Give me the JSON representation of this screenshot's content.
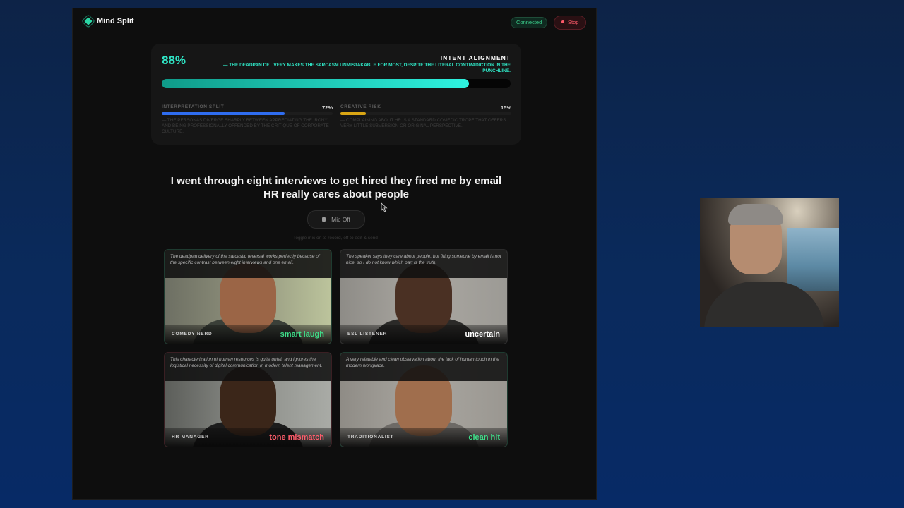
{
  "app": {
    "title": "Mind Split",
    "status": "Connected",
    "stop_label": "Stop"
  },
  "intent": {
    "percent_label": "88%",
    "value": 0.88,
    "title": "INTENT ALIGNMENT",
    "description": "— THE DEADPAN DELIVERY MAKES THE SARCASM UNMISTAKABLE FOR MOST, DESPITE THE LITERAL CONTRADICTION IN THE PUNCHLINE."
  },
  "metrics": [
    {
      "label": "INTERPRETATION SPLIT",
      "value_label": "72%",
      "value": 0.72,
      "color": "#2f6df0",
      "description": "— THE PERSONAS DIVERGE SHARPLY BETWEEN APPRECIATING THE IRONY AND BEING PROFESSIONALLY OFFENDED BY THE CRITIQUE OF CORPORATE CULTURE."
    },
    {
      "label": "CREATIVE RISK",
      "value_label": "15%",
      "value": 0.15,
      "color": "#d9a514",
      "description": "— COMPLAINING ABOUT HR IS A STANDARD COMEDIC TROPE THAT OFFERS VERY LITTLE SUBVERSION OR ORIGINAL PERSPECTIVE."
    }
  ],
  "utterance": "I went through eight interviews to get hired they fired me by email HR really cares about people",
  "mic": {
    "label": "Mic Off",
    "icon": "microphone-icon",
    "hint": "Toggle mic on to record, off to edit & send"
  },
  "personas": [
    {
      "role": "COMEDY NERD",
      "verdict": "smart laugh",
      "verdict_color": "#3ee08a",
      "quote": "The deadpan delivery of the sarcastic reversal works perfectly because of the specific contrast between eight interviews and one email."
    },
    {
      "role": "ESL LISTENER",
      "verdict": "uncertain",
      "verdict_color": "#ffffff",
      "quote": "The speaker says they care about people, but firing someone by email is not nice, so I do not know which part is the truth."
    },
    {
      "role": "HR MANAGER",
      "verdict": "tone mismatch",
      "verdict_color": "#ff5d6c",
      "quote": "This characterization of human resources is quite unfair and ignores the logistical necessity of digital communication in modern talent management."
    },
    {
      "role": "TRADITIONALIST",
      "verdict": "clean hit",
      "verdict_color": "#3ee08a",
      "quote": "A very relatable and clean observation about the lack of human touch in the modern workplace."
    }
  ]
}
